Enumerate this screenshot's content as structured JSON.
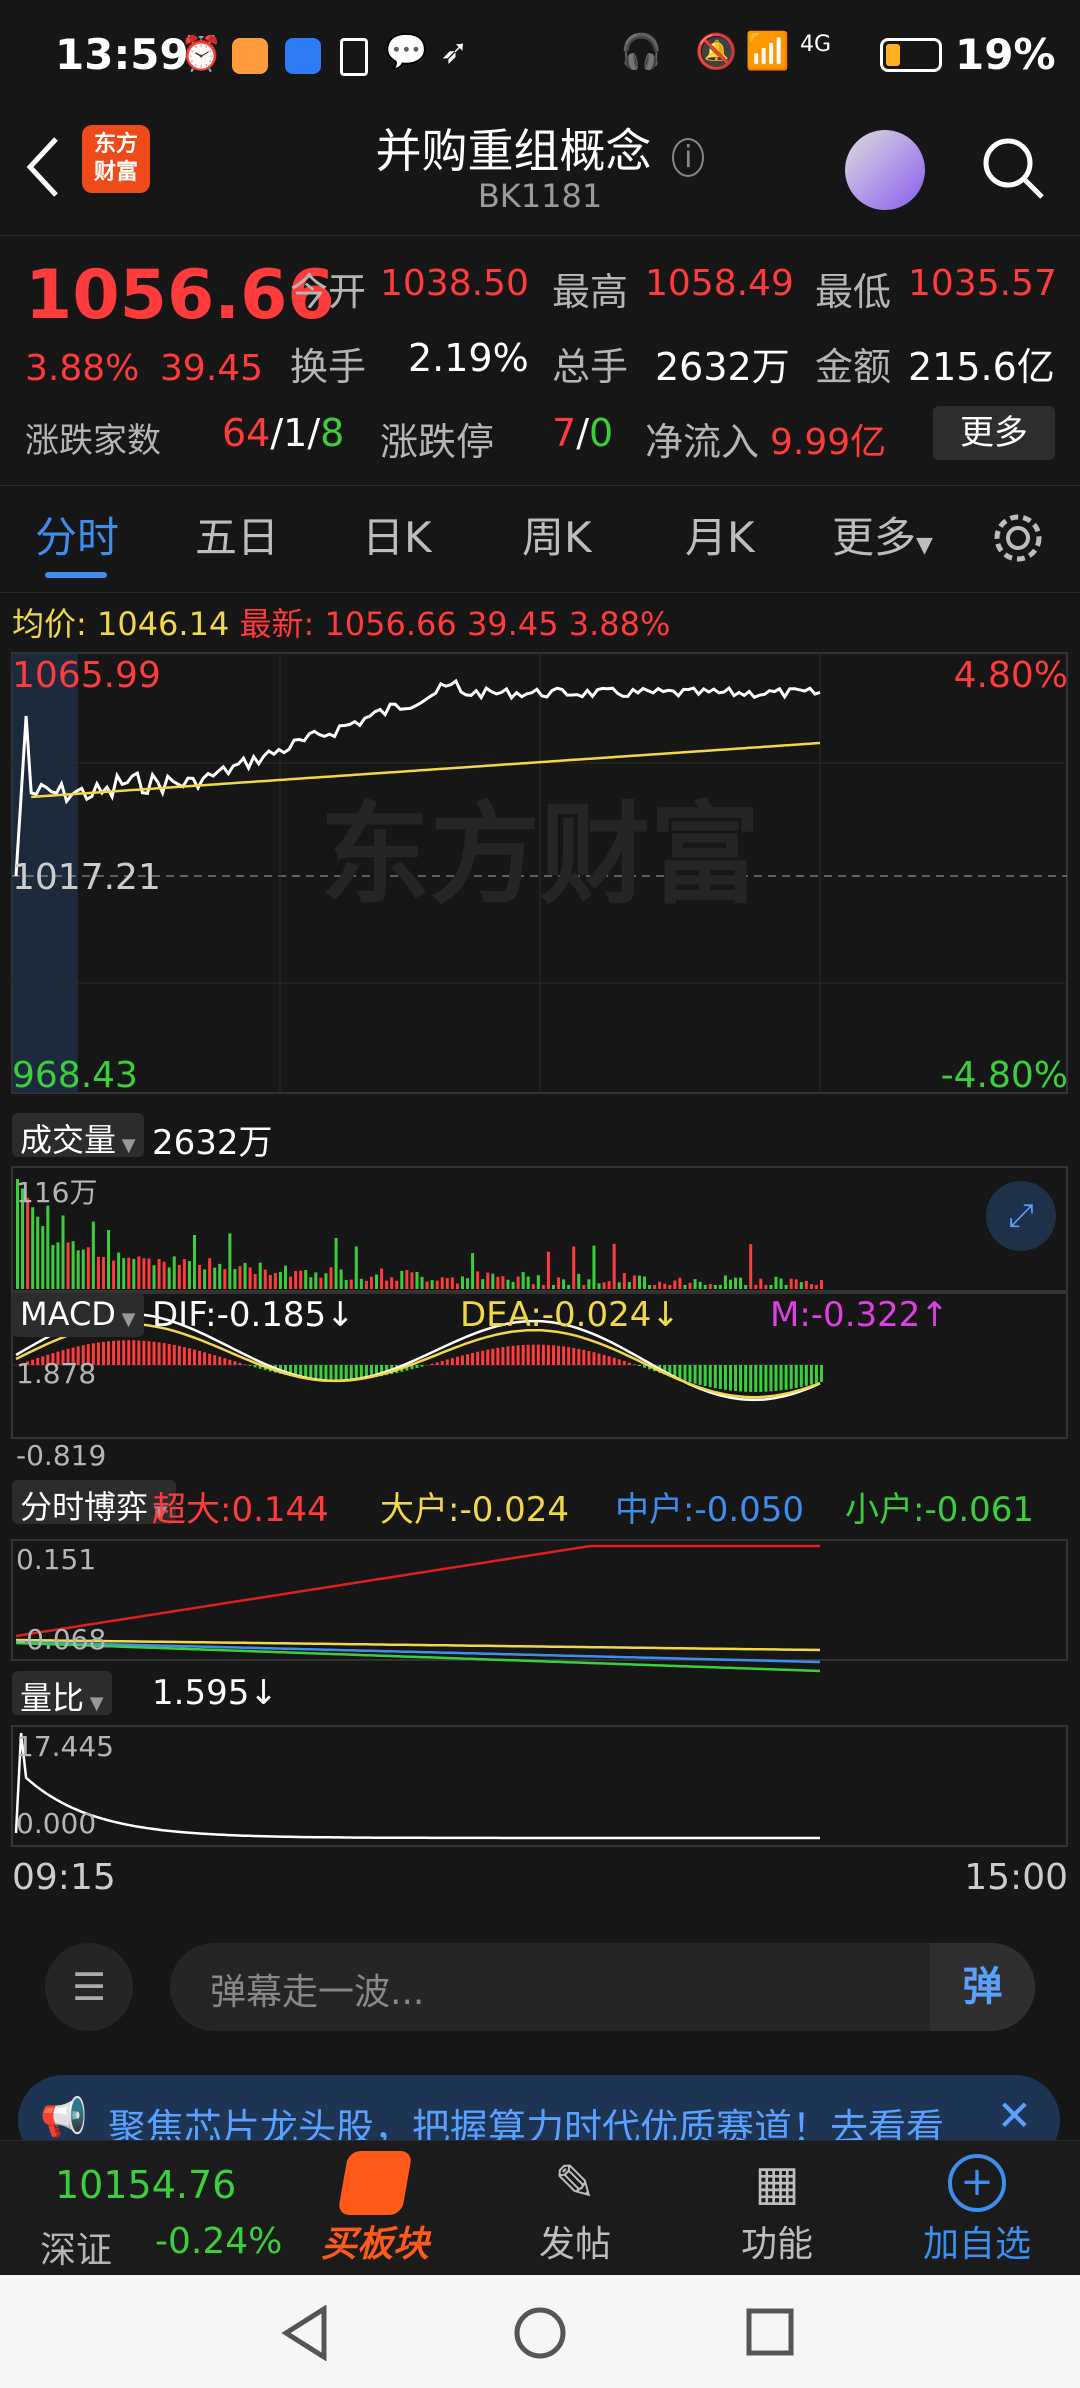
{
  "status": {
    "time": "13:59",
    "battery": "19%",
    "network": "4G"
  },
  "header": {
    "title": "并购重组概念",
    "code": "BK1181",
    "logo_line1": "东方",
    "logo_line2": "财富"
  },
  "quote": {
    "price": "1056.66",
    "change_pct": "3.88%",
    "change": "39.45",
    "open_label": "今开",
    "open": "1038.50",
    "high_label": "最高",
    "high": "1058.49",
    "low_label": "最低",
    "low": "1035.57",
    "turnover_label": "换手",
    "turnover": "2.19%",
    "volume_label": "总手",
    "volume": "2632万",
    "amount_label": "金额",
    "amount": "215.6亿",
    "breadth_label": "涨跌家数",
    "breadth_up": "64",
    "breadth_flat": "1",
    "breadth_down": "8",
    "limit_label": "涨跌停",
    "limit_up": "7",
    "limit_down": "0",
    "inflow_label": "净流入",
    "inflow": "9.99亿",
    "more": "更多"
  },
  "tabs": [
    "分时",
    "五日",
    "日K",
    "周K",
    "月K",
    "更多"
  ],
  "intraday": {
    "avg_label": "均价:",
    "avg": "1046.14",
    "latest_label": "最新:",
    "latest": "1056.66",
    "chg": "39.45",
    "pct": "3.88%",
    "ymax": "1065.99",
    "ymid": "1017.21",
    "ymin": "968.43",
    "pmax": "4.80%",
    "pmin": "-4.80%",
    "watermark": "东方财富",
    "time_start": "09:15",
    "time_end": "15:00"
  },
  "volume": {
    "label": "成交量",
    "total": "2632万",
    "max": "116万"
  },
  "macd": {
    "label": "MACD",
    "dif": "DIF:-0.185↓",
    "dea": "DEA:-0.024↓",
    "m": "M:-0.322↑",
    "top": "1.878",
    "bottom": "-0.819"
  },
  "game": {
    "label": "分时博弈",
    "super": "超大:0.144",
    "big": "大户:-0.024",
    "mid": "中户:-0.050",
    "small": "小户:-0.061",
    "top": "0.151",
    "bottom": "-0.068"
  },
  "ratio": {
    "label": "量比",
    "value": "1.595↓",
    "top": "17.445",
    "bottom": "0.000"
  },
  "danmu": {
    "placeholder": "弹幕走一波...",
    "btn": "弹"
  },
  "banner": {
    "text": "聚焦芯片龙头股，把握算力时代优质赛道！去看看"
  },
  "bottomnav": {
    "index_value": "10154.76",
    "index_name": "深证",
    "index_pct": "-0.24%",
    "buy": "买板块",
    "post": "发帖",
    "func": "功能",
    "add": "加自选"
  },
  "colors": {
    "up": "#ff3b3b",
    "down": "#3ccf3c",
    "avg": "#f0d84a",
    "bg": "#161616"
  }
}
